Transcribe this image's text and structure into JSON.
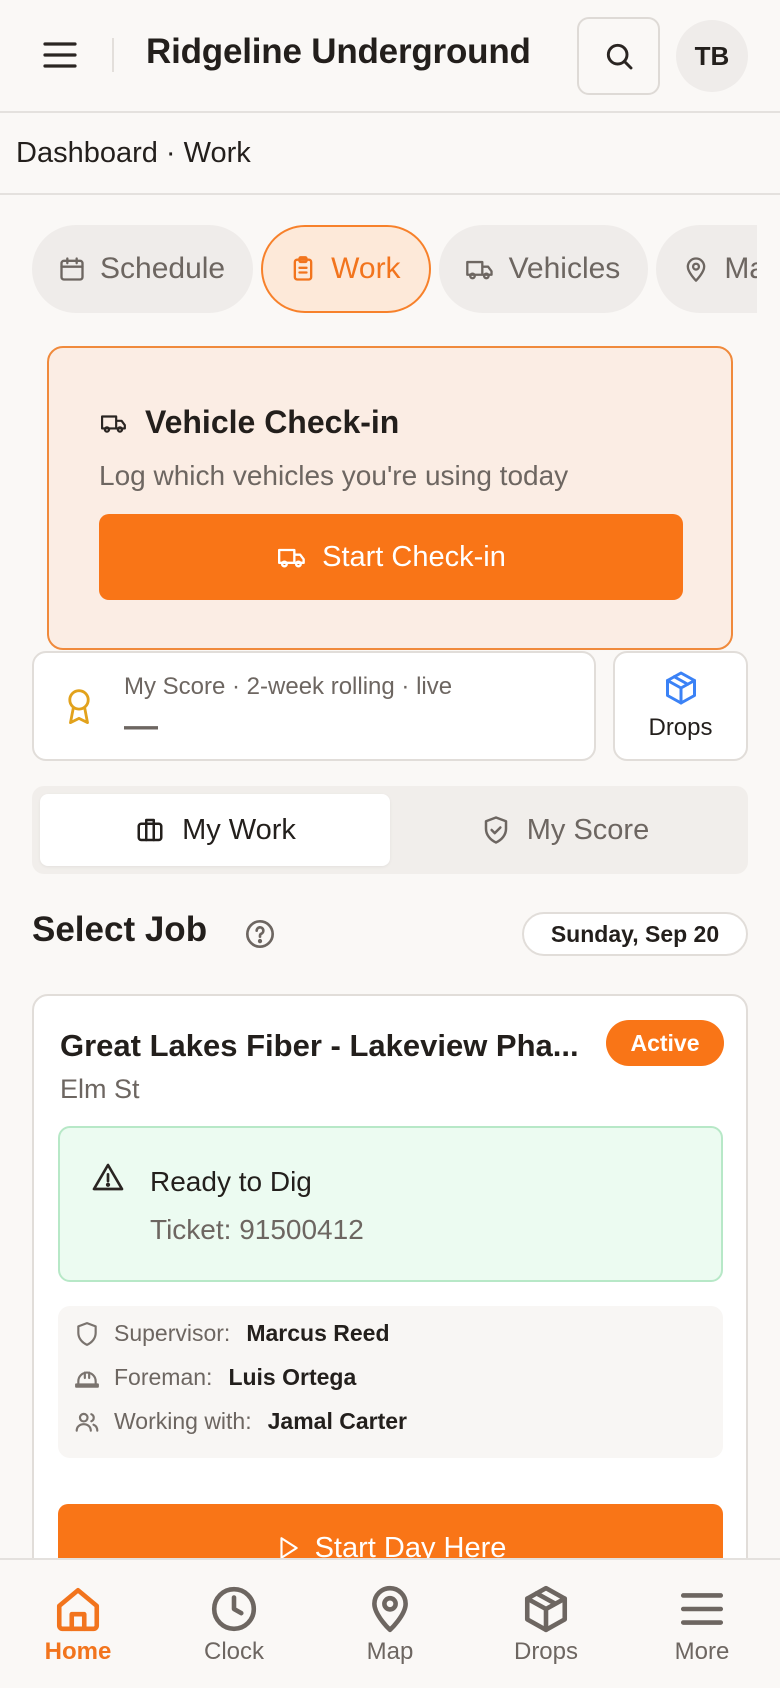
{
  "header": {
    "title": "Ridgeline Underground",
    "avatar_initials": "TB",
    "menu_icon": "hamburger-icon",
    "search_icon": "search-icon"
  },
  "breadcrumb": "Dashboard · Work",
  "tabs": [
    {
      "label": "Schedule",
      "icon": "calendar-icon",
      "active": false
    },
    {
      "label": "Work",
      "icon": "clipboard-icon",
      "active": true
    },
    {
      "label": "Vehicles",
      "icon": "truck-icon",
      "active": false
    },
    {
      "label": "Map",
      "icon": "map-pin-icon",
      "active": false
    }
  ],
  "vehicle_checkin": {
    "title": "Vehicle Check-in",
    "subtitle": "Log which vehicles you're using today",
    "button_label": "Start Check-in"
  },
  "score": {
    "label": "My Score · 2-week rolling · live",
    "value": "—"
  },
  "drops_card": {
    "label": "Drops"
  },
  "segment": [
    {
      "label": "My Work",
      "icon": "briefcase-icon",
      "active": true
    },
    {
      "label": "My Score",
      "icon": "shield-check-icon",
      "active": false
    }
  ],
  "select_job": {
    "title": "Select Job",
    "date": "Sunday, Sep 20"
  },
  "job": {
    "title": "Great Lakes Fiber - Lakeview Pha...",
    "status": "Active",
    "street": "Elm St",
    "dig_status": "Ready to Dig",
    "ticket": "Ticket: 91500412",
    "supervisor_label": "Supervisor:",
    "supervisor": "Marcus Reed",
    "foreman_label": "Foreman:",
    "foreman": "Luis Ortega",
    "working_with_label": "Working with:",
    "working_with": "Jamal Carter",
    "start_button": "Start Day Here"
  },
  "bottom_nav": [
    {
      "label": "Home",
      "icon": "home-icon",
      "active": true
    },
    {
      "label": "Clock",
      "icon": "clock-icon",
      "active": false
    },
    {
      "label": "Map",
      "icon": "map-pin-icon",
      "active": false
    },
    {
      "label": "Drops",
      "icon": "package-icon",
      "active": false
    },
    {
      "label": "More",
      "icon": "hamburger-icon",
      "active": false
    }
  ],
  "colors": {
    "accent": "#f97517",
    "success_bg": "#ecfbf1",
    "award": "#e2a21c",
    "info": "#3b82f6"
  }
}
